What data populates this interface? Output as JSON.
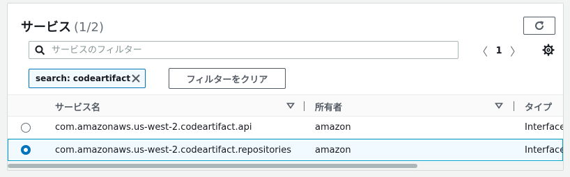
{
  "header": {
    "title": "サービス",
    "count": "(1/2)"
  },
  "search": {
    "placeholder": "サービスのフィルター",
    "value": ""
  },
  "pagination": {
    "current_page": "1",
    "prev": "〈",
    "next": "〉"
  },
  "filter_token": {
    "label": "search: codeartifact"
  },
  "clear_button": {
    "label": "フィルターをクリア"
  },
  "table": {
    "columns": [
      "サービス名",
      "所有者",
      "タイプ"
    ],
    "rows": [
      {
        "service": "com.amazonaws.us-west-2.codeartifact.api",
        "owner": "amazon",
        "type": "Interface",
        "selected": false
      },
      {
        "service": "com.amazonaws.us-west-2.codeartifact.repositories",
        "owner": "amazon",
        "type": "Interface",
        "selected": true
      }
    ]
  },
  "colors": {
    "accent": "#0073bb",
    "selected_row_bg": "#f1faff",
    "selected_row_border": "#00a1c9"
  },
  "icons": [
    "refresh-icon",
    "search-icon",
    "chevron-left-icon",
    "chevron-right-icon",
    "gear-icon",
    "close-icon",
    "sort-icon",
    "radio-icon"
  ]
}
